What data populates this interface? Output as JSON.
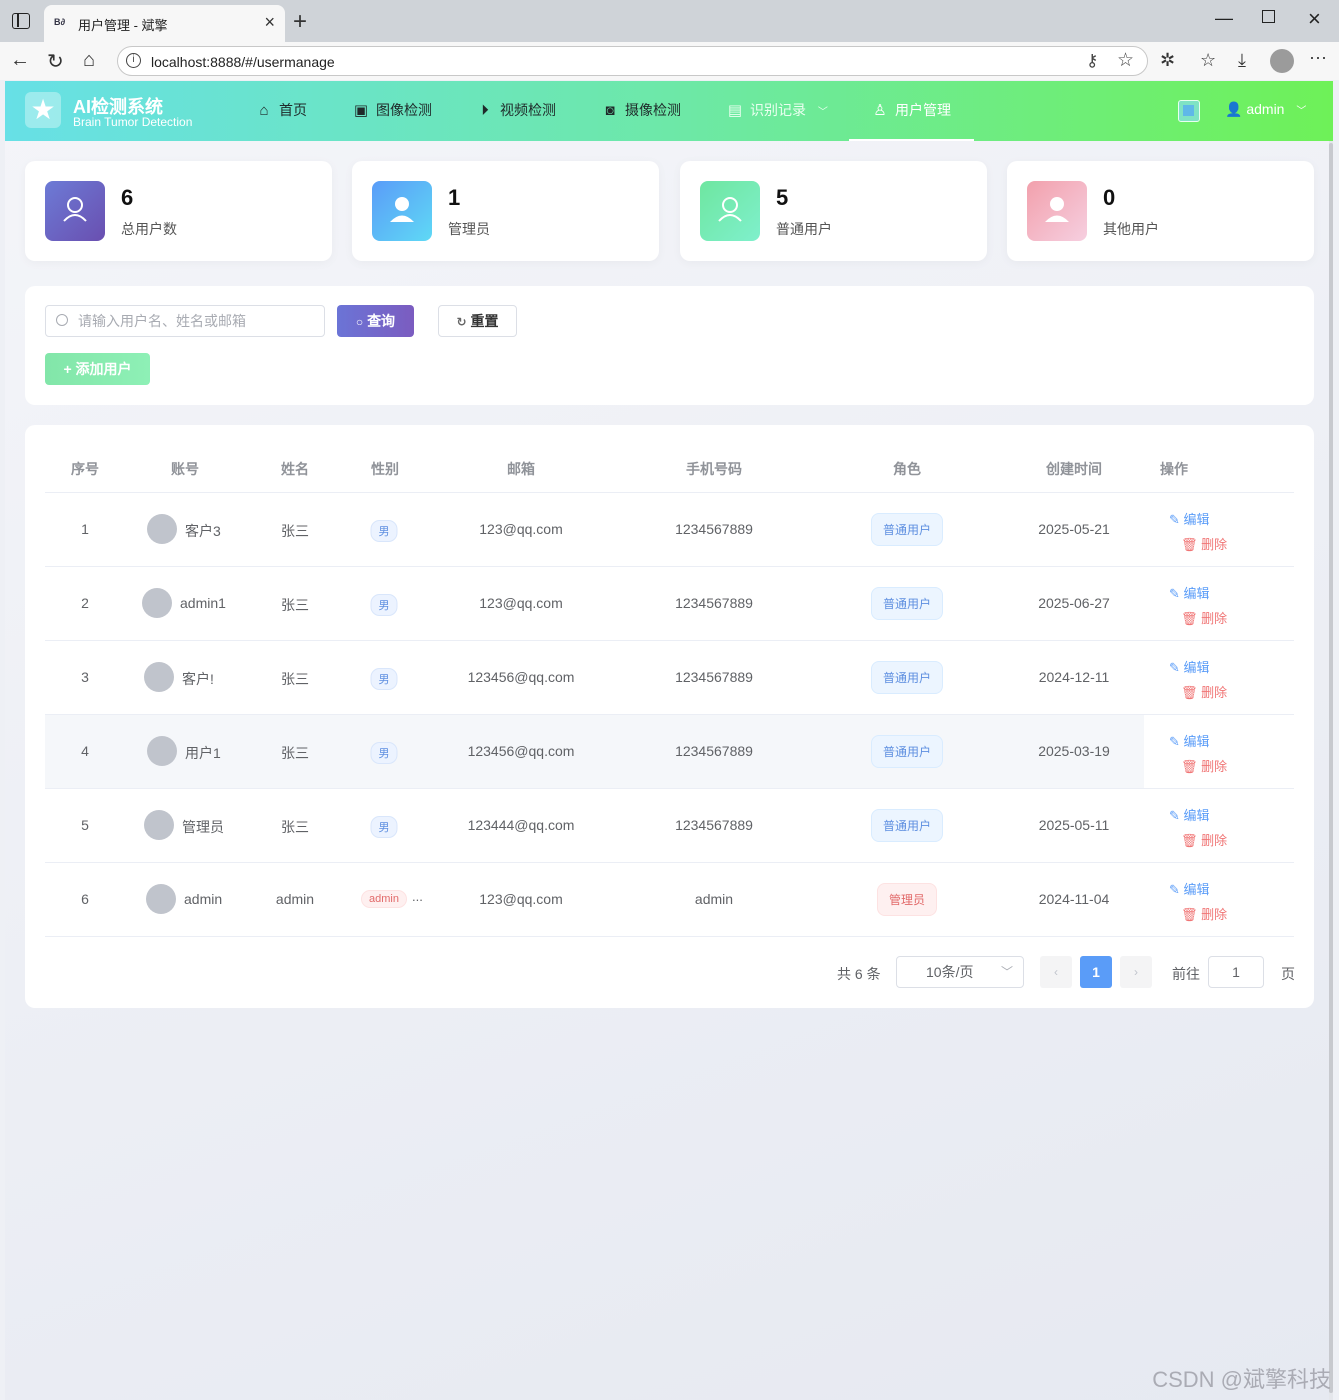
{
  "browser": {
    "tab_favicon": "B∂",
    "tab_title": "用户管理 - 斌擎",
    "url": "localhost:8888/#/usermanage"
  },
  "app": {
    "title": "AI检测系统",
    "subtitle": "Brain Tumor Detection",
    "nav": [
      {
        "label": "首页",
        "icon": "home-icon"
      },
      {
        "label": "图像检测",
        "icon": "image-icon"
      },
      {
        "label": "视频检测",
        "icon": "play-icon"
      },
      {
        "label": "摄像检测",
        "icon": "camera-icon"
      },
      {
        "label": "识别记录",
        "icon": "document-icon"
      },
      {
        "label": "用户管理",
        "icon": "user-icon"
      }
    ],
    "active_nav": "用户管理",
    "user": "admin"
  },
  "stats": [
    {
      "value": "6",
      "label": "总用户数",
      "color": "#6a66c9"
    },
    {
      "value": "1",
      "label": "管理员",
      "color": "#5fb6f9"
    },
    {
      "value": "5",
      "label": "普通用户",
      "color": "#6ee6b0"
    },
    {
      "value": "0",
      "label": "其他用户",
      "color": "#f2a6b6"
    }
  ],
  "search": {
    "placeholder": "请输入用户名、姓名或邮箱",
    "query_label": "查询",
    "reset_label": "重置",
    "add_label": "添加用户"
  },
  "table": {
    "columns": [
      "序号",
      "账号",
      "姓名",
      "性别",
      "邮箱",
      "手机号码",
      "角色",
      "创建时间",
      "操作"
    ],
    "edit_label": "编辑",
    "delete_label": "删除",
    "rows": [
      {
        "index": "1",
        "account": "客户3",
        "name": "张三",
        "gender": "男",
        "email": "123@qq.com",
        "phone": "1234567889",
        "role": "普通用户",
        "created": "2025-05-21"
      },
      {
        "index": "2",
        "account": "admin1",
        "name": "张三",
        "gender": "男",
        "email": "123@qq.com",
        "phone": "1234567889",
        "role": "普通用户",
        "created": "2025-06-27"
      },
      {
        "index": "3",
        "account": "客户!",
        "name": "张三",
        "gender": "男",
        "email": "123456@qq.com",
        "phone": "1234567889",
        "role": "普通用户",
        "created": "2024-12-11"
      },
      {
        "index": "4",
        "account": "用户1",
        "name": "张三",
        "gender": "男",
        "email": "123456@qq.com",
        "phone": "1234567889",
        "role": "普通用户",
        "created": "2025-03-19"
      },
      {
        "index": "5",
        "account": "管理员",
        "name": "张三",
        "gender": "男",
        "email": "123444@qq.com",
        "phone": "1234567889",
        "role": "普通用户",
        "created": "2025-05-11"
      },
      {
        "index": "6",
        "account": "admin",
        "name": "admin",
        "gender": "admin",
        "gender_more": "...",
        "email": "123@qq.com",
        "phone": "admin",
        "role": "管理员",
        "created": "2024-11-04"
      }
    ]
  },
  "pagination": {
    "total": "共 6 条",
    "page_size": "10条/页",
    "current": "1",
    "goto_label": "前往",
    "goto_value": "1",
    "page_suffix": "页"
  },
  "watermark": "CSDN @斌擎科技"
}
